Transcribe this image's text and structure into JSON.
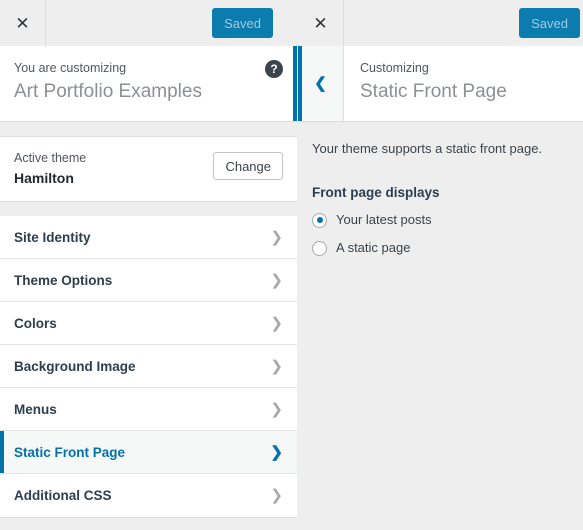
{
  "left_panel": {
    "topbar": {
      "close_icon": "close-icon",
      "save_label": "Saved"
    },
    "customizing_header": {
      "eyebrow": "You are customizing",
      "title": "Art Portfolio Examples",
      "help_icon": "help-icon"
    },
    "active_theme": {
      "eyebrow": "Active theme",
      "name": "Hamilton",
      "change_label": "Change"
    },
    "sections": [
      {
        "label": "Site Identity",
        "active": false
      },
      {
        "label": "Theme Options",
        "active": false
      },
      {
        "label": "Colors",
        "active": false
      },
      {
        "label": "Background Image",
        "active": false
      },
      {
        "label": "Menus",
        "active": false
      },
      {
        "label": "Static Front Page",
        "active": true
      },
      {
        "label": "Additional CSS",
        "active": false
      }
    ]
  },
  "right_panel": {
    "topbar": {
      "close_icon": "close-icon",
      "save_label": "Saved"
    },
    "section_header": {
      "back_icon": "chevron-left-icon",
      "eyebrow": "Customizing",
      "title": "Static Front Page"
    },
    "content": {
      "support_note": "Your theme supports a static front page.",
      "control_title": "Front page displays",
      "options": [
        {
          "label": "Your latest posts",
          "selected": true
        },
        {
          "label": "A static page",
          "selected": false
        }
      ]
    }
  },
  "colors": {
    "accent_blue": "#0073aa",
    "save_button_bg": "#0b7cad",
    "panel_gray": "#eeeeee",
    "divider": "#dddddd",
    "text_dark": "#2f3e4e"
  }
}
